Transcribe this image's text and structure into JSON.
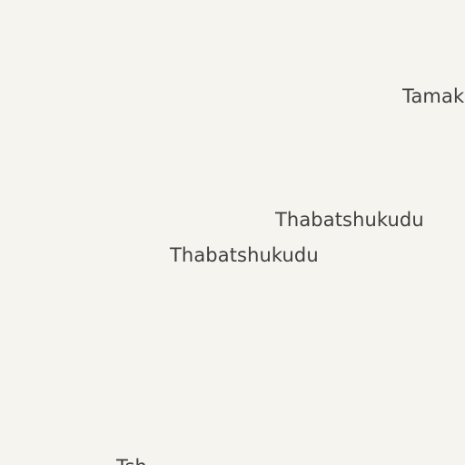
{
  "map": {
    "background_color": "#f6f4ef",
    "label_color": "#3f3f3f",
    "labels": [
      {
        "name": "Tamak"
      },
      {
        "name": "Thabatshukudu"
      },
      {
        "name": "Thabatshukudu"
      },
      {
        "name": "Tsh"
      }
    ]
  }
}
